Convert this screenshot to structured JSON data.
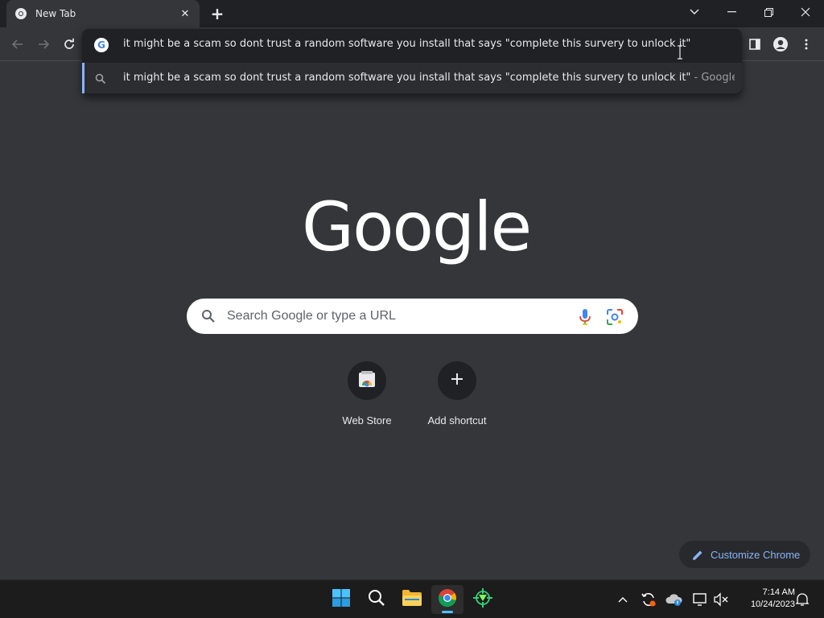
{
  "tab": {
    "title": "New Tab"
  },
  "omnibox": {
    "value": "it might be a scam so dont trust a random software you install that says \"complete this survery to unlock it\"",
    "suggestion_text": "it might be a scam so dont trust a random software you install that says \"complete this survery to unlock it\"",
    "suggestion_suffix": " - Google Sea..."
  },
  "logo": {
    "text": "Google"
  },
  "search": {
    "placeholder": "Search Google or type a URL"
  },
  "shortcuts": [
    {
      "label": "Web Store"
    },
    {
      "label": "Add shortcut"
    }
  ],
  "customize": {
    "label": "Customize Chrome"
  },
  "taskbar": {
    "time": "7:14 AM",
    "date": "10/24/2023"
  },
  "colors": {
    "background": "#35363a",
    "accent": "#8ab4f8",
    "taskbar": "#1c1c1c"
  }
}
